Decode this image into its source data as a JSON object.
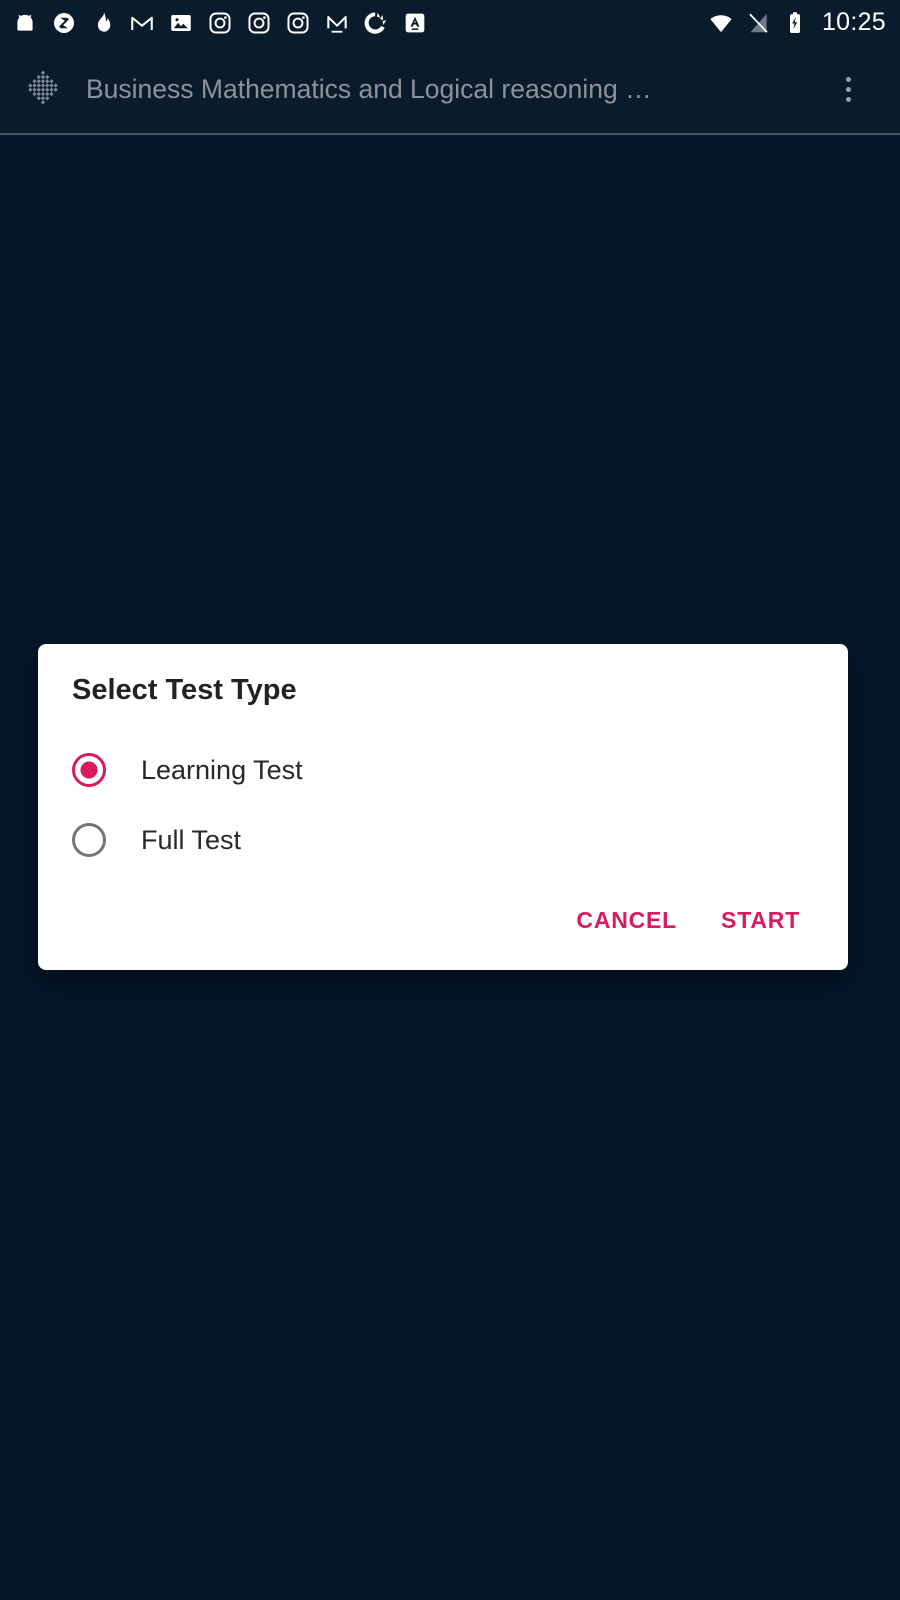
{
  "status_bar": {
    "notification_icons": [
      {
        "name": "android-robot-icon"
      },
      {
        "name": "circle-slash-icon"
      },
      {
        "name": "flame-icon"
      },
      {
        "name": "gmail-icon"
      },
      {
        "name": "photos-icon"
      },
      {
        "name": "instagram-icon"
      },
      {
        "name": "instagram-icon"
      },
      {
        "name": "instagram-icon"
      },
      {
        "name": "medium-icon"
      },
      {
        "name": "donut-chart-icon"
      },
      {
        "name": "boxed-a-icon"
      }
    ],
    "wifi_icon": "wifi-icon",
    "signal_icon": "signal-off-icon",
    "battery_icon": "battery-charging-icon",
    "time": "10:25"
  },
  "app_bar": {
    "logo_icon": "app-logo-icon",
    "title": "Business Mathematics and Logical reasoning …",
    "overflow_icon": "overflow-menu-icon"
  },
  "dialog": {
    "title": "Select Test Type",
    "options": [
      {
        "label": "Learning Test",
        "selected": true
      },
      {
        "label": "Full Test",
        "selected": false
      }
    ],
    "cancel_label": "CANCEL",
    "start_label": "START"
  },
  "colors": {
    "accent": "#d81b60",
    "background": "#04172a",
    "app_bar": "#0a1c2c",
    "dialog_surface": "#ffffff",
    "title_text": "#8d9299",
    "radio_unselected": "#757575"
  }
}
